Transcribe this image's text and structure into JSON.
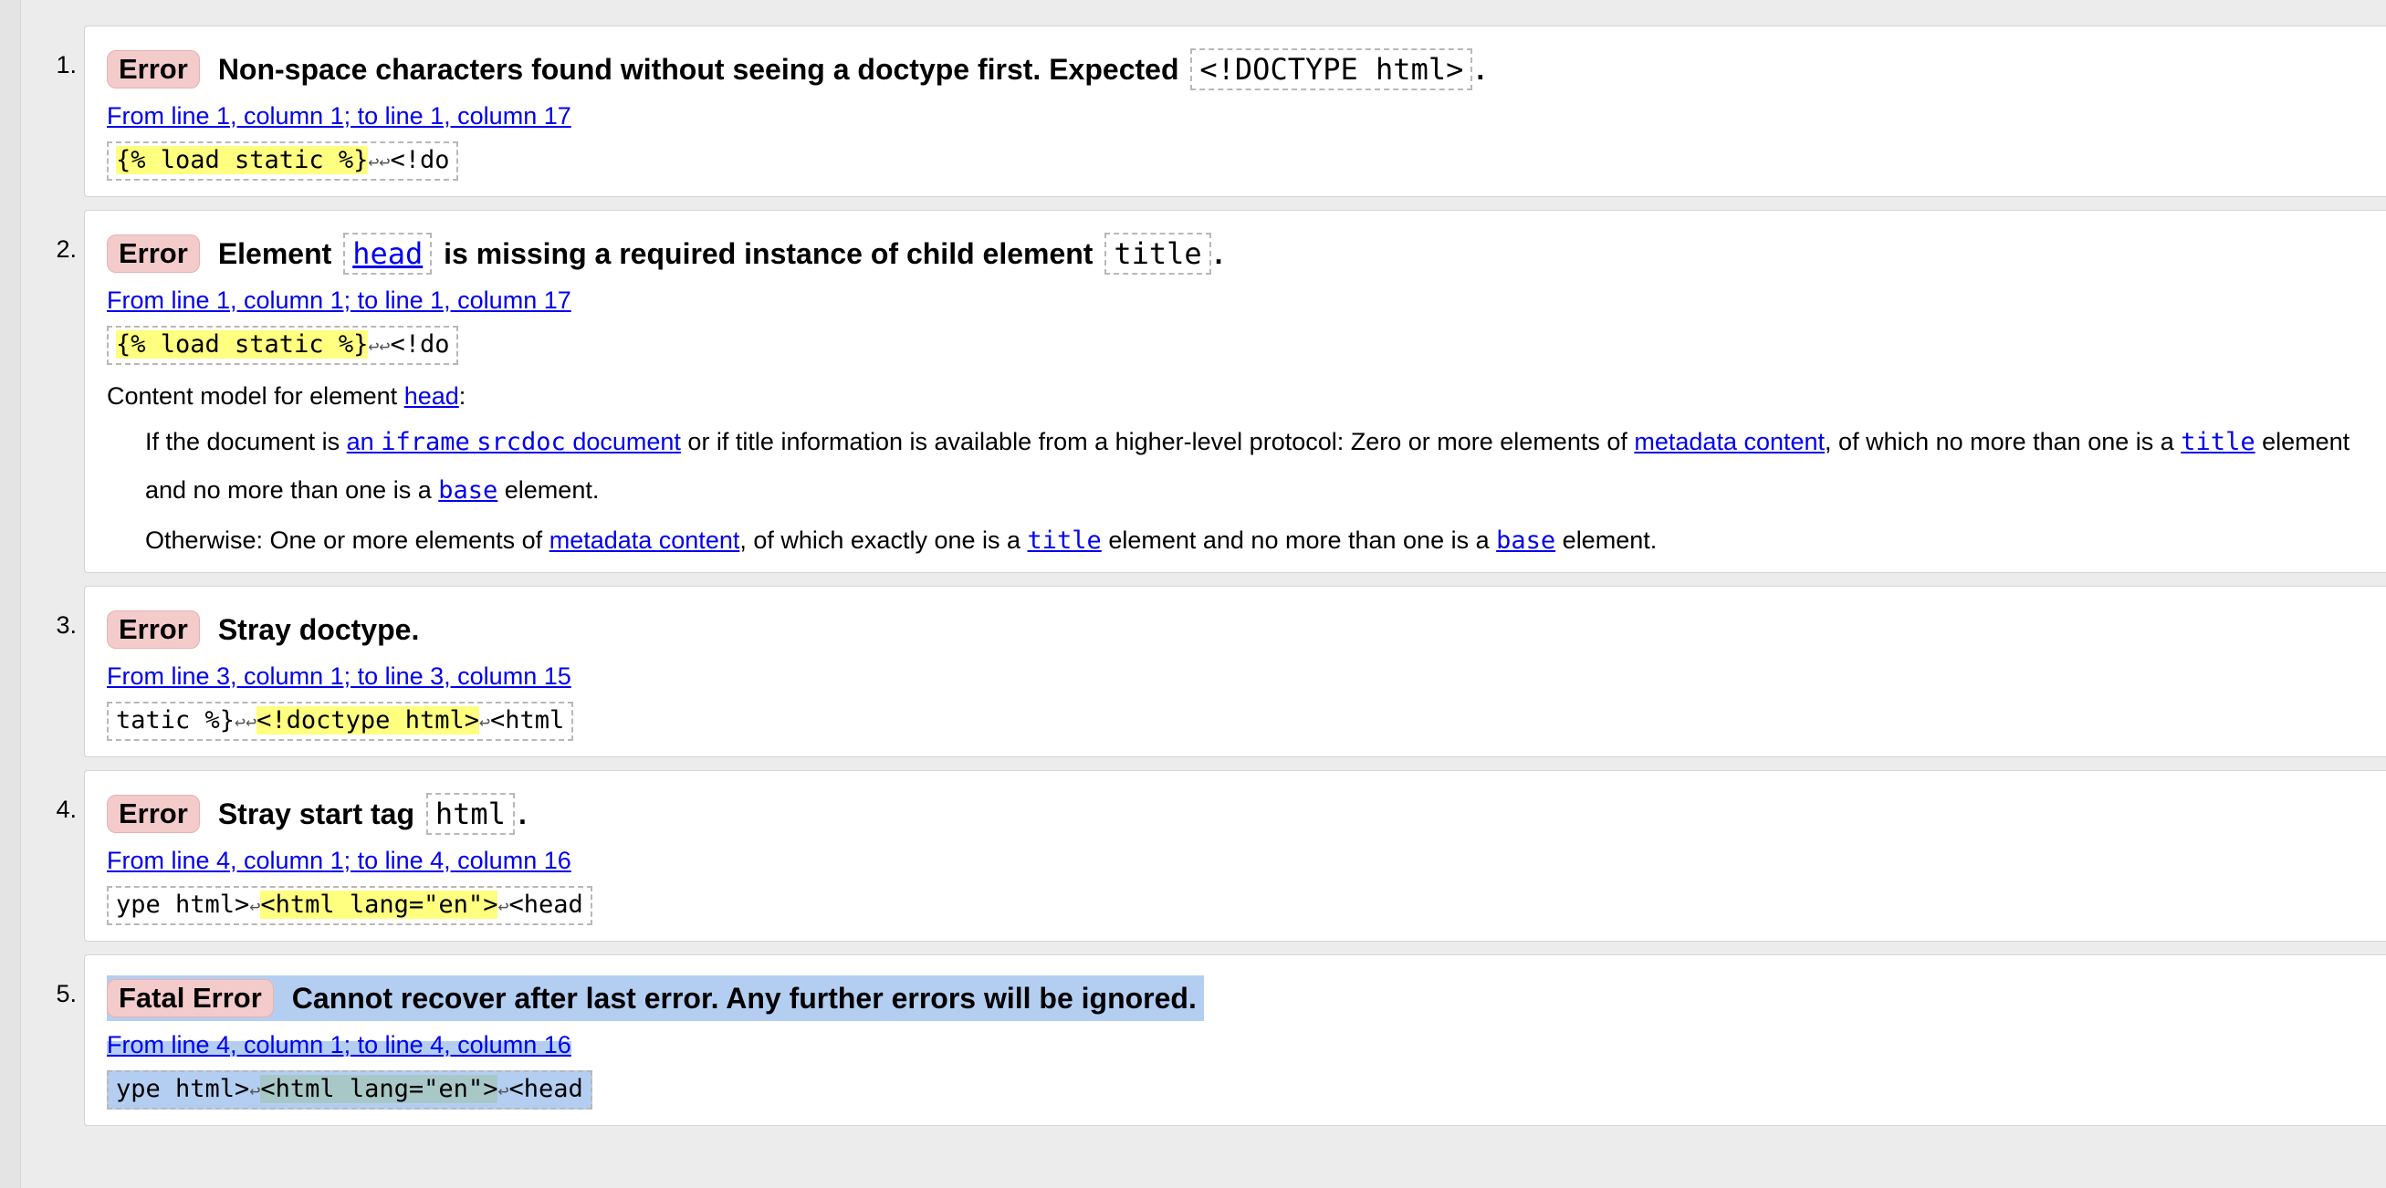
{
  "messages": [
    {
      "number": "1.",
      "badge": "Error",
      "text_before": "Non-space characters found without seeing a doctype first. Expected",
      "code": "<!DOCTYPE html>",
      "text_after": ".",
      "location": "From line 1, column 1; to line 1, column 17",
      "extract_hl": "{% load static %}",
      "extract_rest": "<!do"
    },
    {
      "number": "2.",
      "badge": "Error",
      "text_before": "Element",
      "code_link": "head",
      "text_mid": "is missing a required instance of child element",
      "code": "title",
      "text_after": ".",
      "location": "From line 1, column 1; to line 1, column 17",
      "extract_hl": "{% load static %}",
      "extract_rest": "<!do",
      "content_model": {
        "intro": "Content model for element",
        "intro_link": "head",
        "intro_end": ":",
        "p1_a": "If the document is",
        "p1_link1a": "an",
        "p1_link1b": "iframe",
        "p1_link1c": "srcdoc",
        "p1_link1d": "document",
        "p1_b": "or if title information is available from a higher-level protocol: Zero or more elements of",
        "p1_link2": "metadata content",
        "p1_c": ", of which no more than one is a",
        "p1_link3": "title",
        "p1_d": "element and no more than one is a",
        "p1_link4": "base",
        "p1_e": "element.",
        "p2_a": "Otherwise: One or more elements of",
        "p2_link1": "metadata content",
        "p2_b": ", of which exactly one is a",
        "p2_link2": "title",
        "p2_c": "element and no more than one is a",
        "p2_link3": "base",
        "p2_d": "element."
      }
    },
    {
      "number": "3.",
      "badge": "Error",
      "text_before": "Stray doctype.",
      "location": "From line 3, column 1; to line 3, column 15",
      "extract_pre": "tatic %}",
      "extract_hl": "<!doctype html>",
      "extract_rest": "<html"
    },
    {
      "number": "4.",
      "badge": "Error",
      "text_before": "Stray start tag",
      "code": "html",
      "text_after": ".",
      "location": "From line 4, column 1; to line 4, column 16",
      "extract_pre": "ype html>",
      "extract_hl": "<html lang=\"en\">",
      "extract_rest": "<head"
    },
    {
      "number": "5.",
      "badge": "Fatal Error",
      "text_before": "Cannot recover after last error. Any further errors will be ignored.",
      "location": "From line 4, column 1; to line 4, column 16",
      "extract_pre": "ype html>",
      "extract_hl": "<html lang=\"en\">",
      "extract_rest": "<head"
    }
  ],
  "newline_glyph": "↩"
}
